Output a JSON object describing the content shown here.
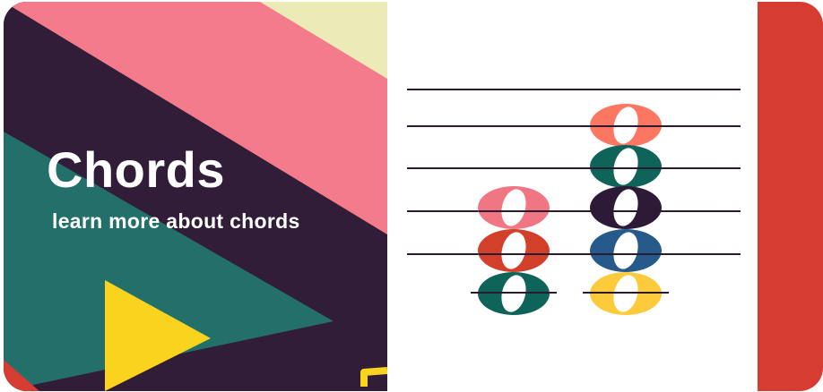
{
  "card": {
    "title": "Chords",
    "subtitle": "learn more about chords"
  },
  "colors": {
    "background_dark": "#311d38",
    "pink": "#f47b8b",
    "cream": "#ecebb8",
    "teal": "#23706a",
    "yellow": "#fad31f",
    "red": "#d63c31",
    "staff_line": "#2c1a30",
    "note_salmon": "#fb7762",
    "note_teal": "#0f6459",
    "note_plum": "#2c1a37",
    "note_blue": "#255a8a",
    "note_yellow": "#fcca3a",
    "note_pink": "#f17684",
    "note_red": "#d2402b"
  },
  "icons": {
    "play": "play-triangle-icon"
  },
  "notation": {
    "chords": [
      {
        "name": "chord-1",
        "notes": [
          "pink",
          "red",
          "teal"
        ]
      },
      {
        "name": "chord-2",
        "notes": [
          "salmon",
          "teal",
          "plum",
          "blue",
          "yellow"
        ]
      }
    ]
  }
}
